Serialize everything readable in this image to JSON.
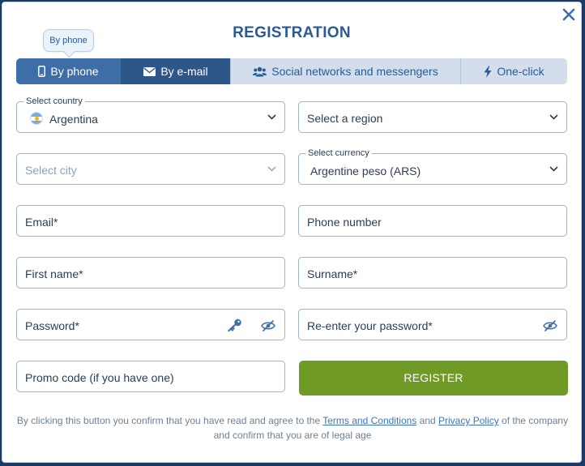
{
  "modal": {
    "title": "REGISTRATION",
    "close_icon": "close-icon"
  },
  "tooltip": "By phone",
  "tabs": [
    {
      "label": "By phone",
      "icon": "phone-icon"
    },
    {
      "label": "By e-mail",
      "icon": "envelope-icon"
    },
    {
      "label": "Social networks and messengers",
      "icon": "users-icon"
    },
    {
      "label": "One-click",
      "icon": "lightning-icon"
    }
  ],
  "form": {
    "country": {
      "label": "Select country",
      "value": "Argentina"
    },
    "region": {
      "placeholder": "Select a region"
    },
    "city": {
      "placeholder": "Select city"
    },
    "currency": {
      "label": "Select currency",
      "value": "Argentine peso (ARS)"
    },
    "email": {
      "placeholder": "Email*"
    },
    "phone": {
      "placeholder": "Phone number"
    },
    "first_name": {
      "placeholder": "First name*"
    },
    "surname": {
      "placeholder": "Surname*"
    },
    "password": {
      "placeholder": "Password*"
    },
    "password_repeat": {
      "placeholder": "Re-enter your password*"
    },
    "promo": {
      "placeholder": "Promo code (if you have one)"
    },
    "register_label": "REGISTER"
  },
  "disclaimer": {
    "part1": "By clicking this button you confirm that you have read and agree to the ",
    "terms_link": "Terms and Conditions",
    "and": " and ",
    "privacy_link": "Privacy Policy",
    "part2": " of the company",
    "line2": "and confirm that you are of legal age"
  },
  "colors": {
    "accent": "#2a5a96",
    "tab_active": "#3d6ea8",
    "register": "#6f9a25",
    "link": "#3c74c0"
  }
}
